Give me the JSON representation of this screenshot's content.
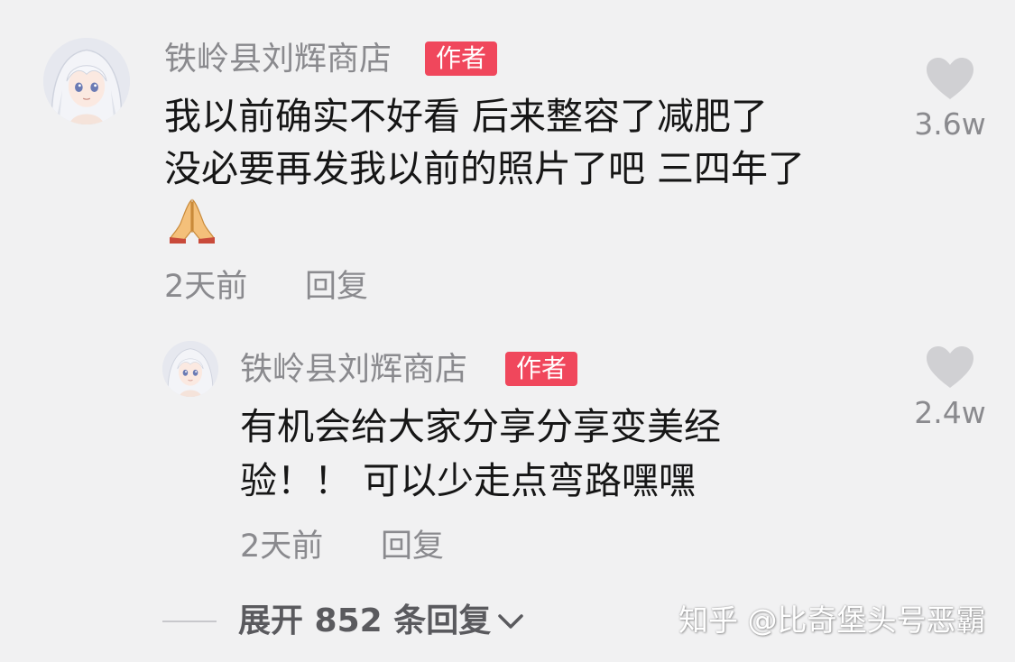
{
  "comments": [
    {
      "username": "铁岭县刘辉商店",
      "tag": "作者",
      "lines": [
        "我以前确实不好看 后来整容了减肥了",
        "没必要再发我以前的照片了吧 三四年了"
      ],
      "emoji": "folded-hands-icon",
      "time": "2天前",
      "reply": "回复",
      "likes": "3.6w"
    },
    {
      "username": "铁岭县刘辉商店",
      "tag": "作者",
      "lines": [
        "有机会给大家分享分享变美经",
        "验！！ 可以少走点弯路嘿嘿"
      ],
      "time": "2天前",
      "reply": "回复",
      "likes": "2.4w"
    }
  ],
  "expand": {
    "label": "展开 852 条回复",
    "icon": "chevron-down-icon"
  },
  "watermark": "知乎 @比奇堡头号恶霸",
  "colors": {
    "background": "#f1f1f2",
    "author_tag": "#f0475c",
    "heart": "#d0d0d3",
    "meta": "#8a8a8e",
    "text": "#161616"
  }
}
